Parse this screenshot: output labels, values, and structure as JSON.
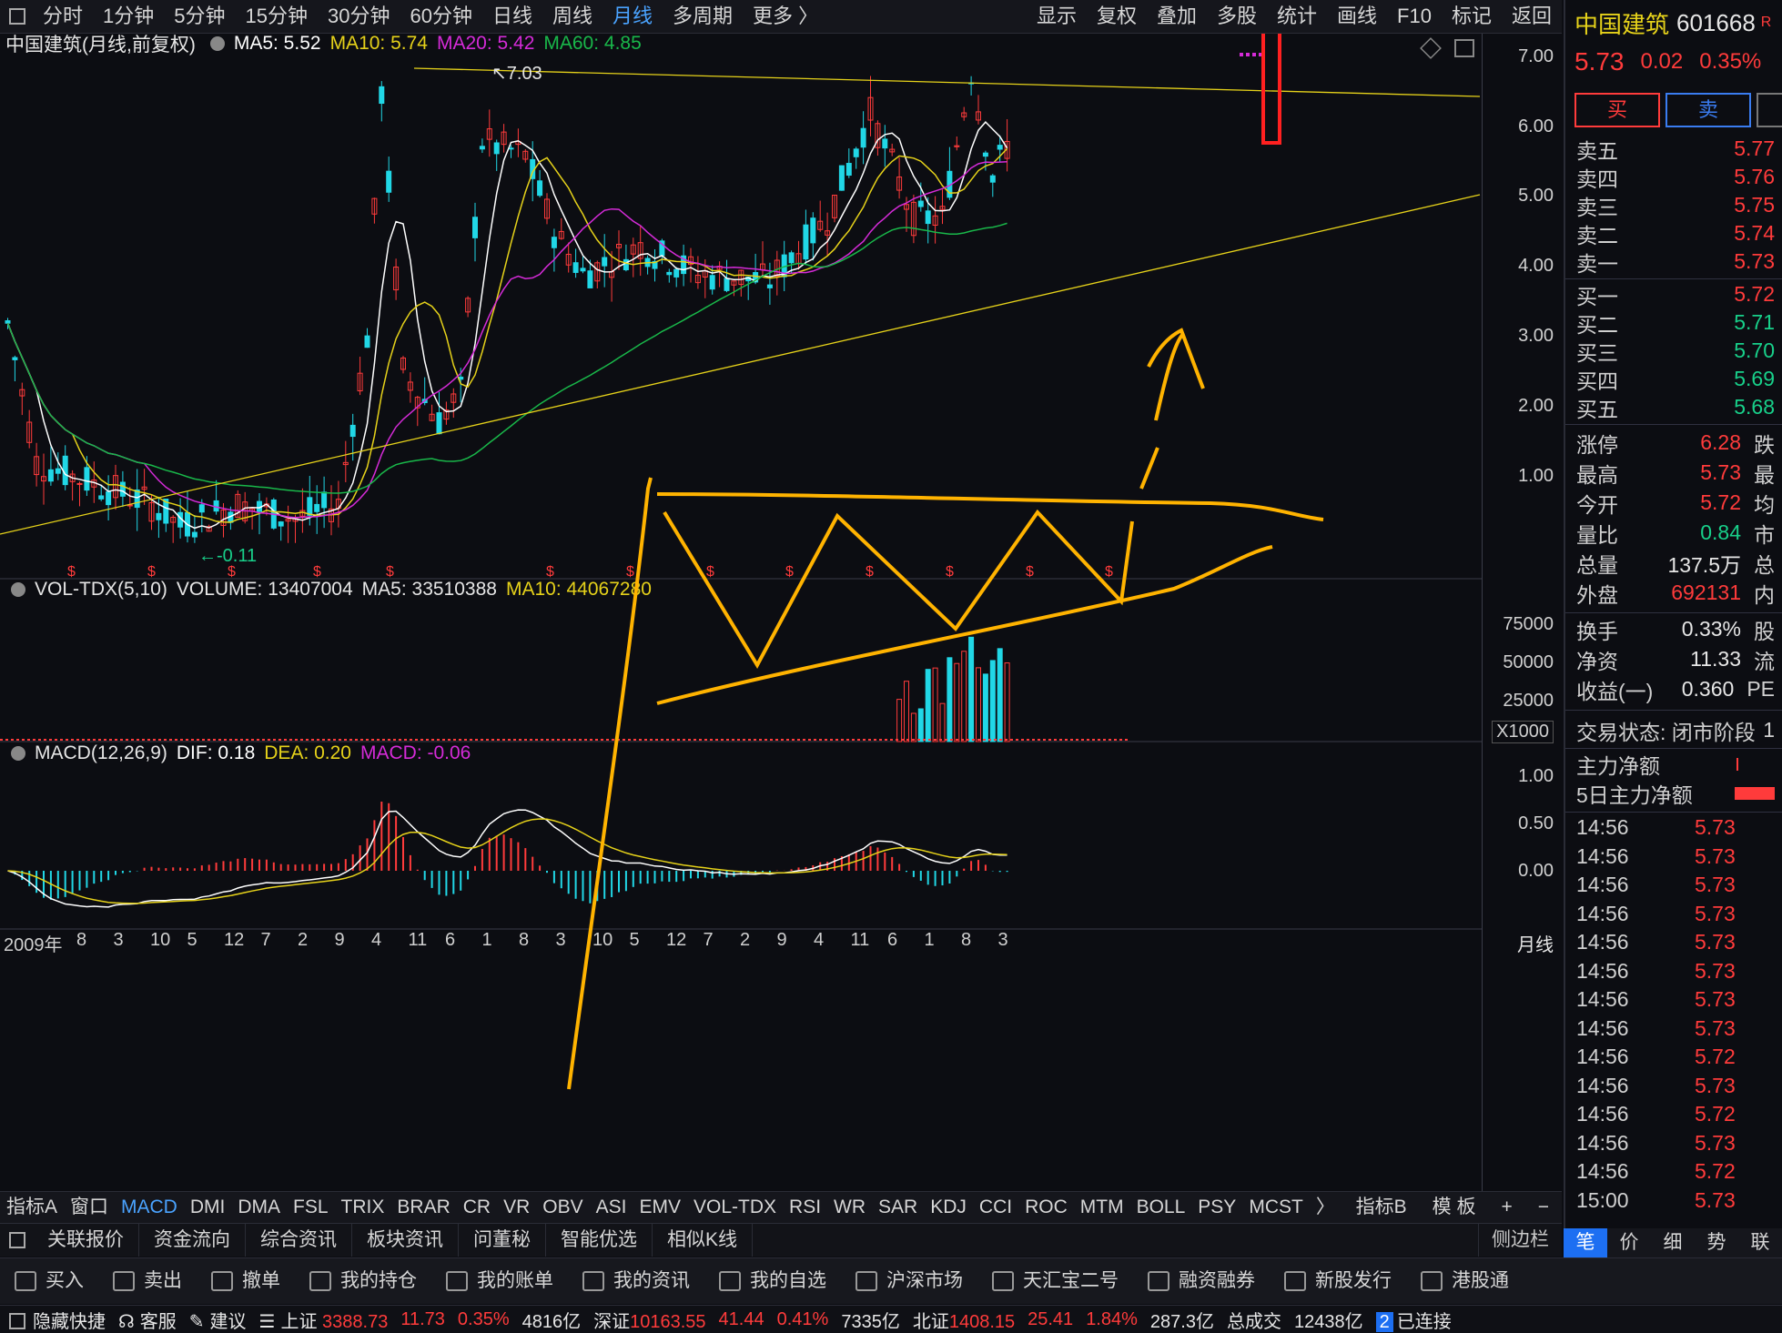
{
  "topbar": {
    "periods": [
      "分时",
      "1分钟",
      "5分钟",
      "15分钟",
      "30分钟",
      "60分钟",
      "日线",
      "周线",
      "月线",
      "多周期",
      "更多 〉"
    ],
    "active_period": "月线",
    "tools": [
      "显示",
      "复权",
      "叠加",
      "多股",
      "统计",
      "画线",
      "F10",
      "标记",
      "返回"
    ]
  },
  "main_legend": {
    "title": "中国建筑(月线,前复权)",
    "ma5": "MA5: 5.52",
    "ma10": "MA10: 5.74",
    "ma20": "MA20: 5.42",
    "ma60": "MA60: 4.85",
    "high_label": "7.03",
    "low_label": "0.11",
    "dividend_mark": "$"
  },
  "price_axis": [
    "7.00",
    "6.00",
    "5.00",
    "4.00",
    "3.00",
    "2.00",
    "1.00"
  ],
  "vol_legend": {
    "title": "VOL-TDX(5,10)",
    "volume": "VOLUME: 13407004",
    "ma5": "MA5: 33510388",
    "ma10": "MA10: 44067280"
  },
  "vol_axis": [
    "75000",
    "50000",
    "25000"
  ],
  "vol_unit": "X1000",
  "macd_legend": {
    "title": "MACD(12,26,9)",
    "dif": "DIF: 0.18",
    "dea": "DEA: 0.20",
    "macd": "MACD: -0.06"
  },
  "macd_axis": [
    "1.00",
    "0.50",
    "0.00"
  ],
  "x_axis": [
    "2009年",
    "8",
    "3",
    "10",
    "5",
    "12",
    "7",
    "2",
    "9",
    "4",
    "11",
    "6",
    "1",
    "8",
    "3",
    "10",
    "5",
    "12",
    "7",
    "2",
    "9",
    "4",
    "11",
    "6",
    "1",
    "8",
    "3"
  ],
  "period_label": "月线",
  "indicator_tabs": [
    "指标A",
    "窗口",
    "MACD",
    "DMI",
    "DMA",
    "FSL",
    "TRIX",
    "BRAR",
    "CR",
    "VR",
    "OBV",
    "ASI",
    "EMV",
    "VOL-TDX",
    "RSI",
    "WR",
    "SAR",
    "KDJ",
    "CCI",
    "ROC",
    "MTM",
    "BOLL",
    "PSY",
    "MCST",
    "〉"
  ],
  "indicator_active": "MACD",
  "indicator_right": [
    "指标B",
    "模 板",
    "+",
    "−"
  ],
  "info_tabs": [
    "关联报价",
    "资金流向",
    "综合资讯",
    "板块资讯",
    "问董秘",
    "智能优选",
    "相似K线"
  ],
  "side_label": "侧边栏",
  "toolbar": [
    "买入",
    "卖出",
    "撤单",
    "我的持仓",
    "我的账单",
    "我的资讯",
    "我的自选",
    "沪深市场",
    "天汇宝二号",
    "融资融券",
    "新股发行",
    "港股通"
  ],
  "status": {
    "hide": "隐藏快捷",
    "service": "客服",
    "suggest": "建议",
    "sh_label": "上证",
    "sh_value": "3388.73",
    "sh_change": "11.73",
    "sh_pct": "0.35%",
    "sh_amount": "4816亿",
    "sz_label": "深证",
    "sz_value": "10163.55",
    "sz_change": "41.44",
    "sz_pct": "0.41%",
    "sz_amount": "7335亿",
    "bz_label": "北证",
    "bz_value": "1408.15",
    "bz_change": "25.41",
    "bz_pct": "1.84%",
    "bz_amount": "287.3亿",
    "total_label": "总成交",
    "total_value": "12438亿",
    "conn_count": "2",
    "conn_label": "已连接"
  },
  "quote": {
    "name": "中国建筑",
    "code": "601668",
    "code_suffix": "R",
    "price": "5.73",
    "change": "0.02",
    "pct": "0.35%",
    "buy_btn": "买",
    "sell_btn": "卖",
    "asks": [
      {
        "label": "卖五",
        "price": "5.77"
      },
      {
        "label": "卖四",
        "price": "5.76"
      },
      {
        "label": "卖三",
        "price": "5.75"
      },
      {
        "label": "卖二",
        "price": "5.74"
      },
      {
        "label": "卖一",
        "price": "5.73"
      }
    ],
    "bids": [
      {
        "label": "买一",
        "price": "5.72"
      },
      {
        "label": "买二",
        "price": "5.71"
      },
      {
        "label": "买三",
        "price": "5.70"
      },
      {
        "label": "买四",
        "price": "5.69"
      },
      {
        "label": "买五",
        "price": "5.68"
      }
    ],
    "stats": [
      {
        "label": "涨停",
        "value": "6.28",
        "color": "red",
        "extra": "跌"
      },
      {
        "label": "最高",
        "value": "5.73",
        "color": "red",
        "extra": "最"
      },
      {
        "label": "今开",
        "value": "5.72",
        "color": "red",
        "extra": "均"
      },
      {
        "label": "量比",
        "value": "0.84",
        "color": "green",
        "extra": "市"
      },
      {
        "label": "总量",
        "value": "137.5万",
        "color": "white",
        "extra": "总"
      },
      {
        "label": "外盘",
        "value": "692131",
        "color": "red",
        "extra": "内"
      }
    ],
    "stats2": [
      {
        "label": "换手",
        "value": "0.33%",
        "extra": "股"
      },
      {
        "label": "净资",
        "value": "11.33",
        "extra": "流"
      },
      {
        "label": "收益(一)",
        "value": "0.360",
        "extra": "PE"
      }
    ],
    "trade_state": "交易状态: 闭市阶段",
    "trade_state_extra": "1",
    "main_net": "主力净额",
    "main_net5": "5日主力净额",
    "ticks": [
      {
        "time": "14:56",
        "price": "5.73"
      },
      {
        "time": "14:56",
        "price": "5.73"
      },
      {
        "time": "14:56",
        "price": "5.73"
      },
      {
        "time": "14:56",
        "price": "5.73"
      },
      {
        "time": "14:56",
        "price": "5.73"
      },
      {
        "time": "14:56",
        "price": "5.73"
      },
      {
        "time": "14:56",
        "price": "5.73"
      },
      {
        "time": "14:56",
        "price": "5.73"
      },
      {
        "time": "14:56",
        "price": "5.72"
      },
      {
        "time": "14:56",
        "price": "5.73"
      },
      {
        "time": "14:56",
        "price": "5.72"
      },
      {
        "time": "14:56",
        "price": "5.73"
      },
      {
        "time": "14:56",
        "price": "5.72"
      },
      {
        "time": "15:00",
        "price": "5.73"
      }
    ],
    "bottom_tabs": [
      "笔",
      "价",
      "细",
      "势",
      "联"
    ],
    "bottom_active": "笔"
  },
  "colors": {
    "up": "#ff3b3b",
    "down": "#21d7e6",
    "ma5": "#ffffff",
    "ma10": "#e6d21a",
    "ma20": "#d52bd8",
    "ma60": "#19b84a",
    "annot": "#ffb300"
  }
}
